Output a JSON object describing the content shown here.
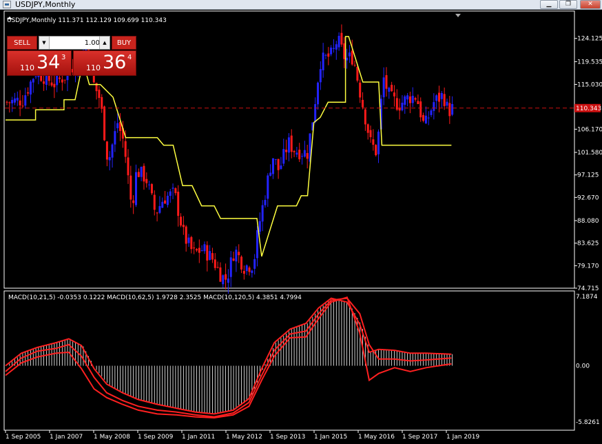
{
  "window": {
    "title": "USDJPY,Monthly",
    "minimize_glyph": "▁",
    "maximize_glyph": "❐",
    "close_glyph": "✕"
  },
  "chart_info": {
    "symbol_line": "USDJPY,Monthly  111.371 112.129 109.699 110.343",
    "indicator_line": "MACD(10,21,5) -0.0353 0.1222  MACD(10,62,5) 1.9728 2.3525  MACD(10,120,5) 4.3851 4.7994"
  },
  "trade_panel": {
    "sell_label": "SELL",
    "buy_label": "BUY",
    "lot_value": "1.00",
    "sell_prefix": "110",
    "sell_big": "34",
    "sell_sup": "3",
    "buy_prefix": "110",
    "buy_big": "36",
    "buy_sup": "4"
  },
  "colors": {
    "background": "#000000",
    "bull": "#2323ff",
    "bear": "#ff1a1a",
    "trail": "#ffff40",
    "macd": "#ff2020",
    "histogram": "#ffffff",
    "current_price_line": "#cc1111"
  },
  "chart_data": {
    "type": "candlestick",
    "price_axis": {
      "ticks": [
        "124.125",
        "119.535",
        "115.030",
        "110.343",
        "106.170",
        "101.580",
        "97.125",
        "92.670",
        "88.080",
        "83.625",
        "79.170",
        "74.715"
      ],
      "current_price": "110.343",
      "range": [
        74.715,
        126.0
      ]
    },
    "macd_axis": {
      "ticks": [
        "7.1874",
        "0.00",
        "-5.8261"
      ],
      "range": [
        -5.8261,
        7.1874
      ]
    },
    "x_labels": [
      "1 Sep 2005",
      "1 Jan 2007",
      "1 May 2008",
      "1 Sep 2009",
      "1 Jan 2011",
      "1 May 2012",
      "1 Sep 2013",
      "1 Jan 2015",
      "1 May 2016",
      "1 Sep 2017",
      "1 Jan 2019"
    ],
    "start_year": 2005.0,
    "end_year": 2019.2,
    "close_path": [
      [
        2005.0,
        111.5
      ],
      [
        2005.5,
        112.0
      ],
      [
        2005.9,
        117.5
      ],
      [
        2006.2,
        116.5
      ],
      [
        2006.5,
        115.2
      ],
      [
        2006.9,
        117.0
      ],
      [
        2007.3,
        120.5
      ],
      [
        2007.5,
        122.5
      ],
      [
        2007.7,
        115.8
      ],
      [
        2007.95,
        112.0
      ],
      [
        2008.2,
        99.5
      ],
      [
        2008.5,
        107.5
      ],
      [
        2008.7,
        103.5
      ],
      [
        2008.95,
        90.5
      ],
      [
        2009.1,
        98.0
      ],
      [
        2009.4,
        96.5
      ],
      [
        2009.7,
        89.5
      ],
      [
        2009.95,
        92.5
      ],
      [
        2010.3,
        93.5
      ],
      [
        2010.6,
        85.0
      ],
      [
        2010.9,
        81.5
      ],
      [
        2011.2,
        82.5
      ],
      [
        2011.5,
        80.5
      ],
      [
        2011.8,
        77.0
      ],
      [
        2011.95,
        76.5
      ],
      [
        2012.2,
        82.5
      ],
      [
        2012.5,
        79.0
      ],
      [
        2012.8,
        79.5
      ],
      [
        2012.95,
        86.5
      ],
      [
        2013.2,
        94.5
      ],
      [
        2013.4,
        101.0
      ],
      [
        2013.6,
        98.0
      ],
      [
        2013.9,
        103.5
      ],
      [
        2014.1,
        102.0
      ],
      [
        2014.5,
        101.5
      ],
      [
        2014.7,
        109.5
      ],
      [
        2014.9,
        119.5
      ],
      [
        2015.3,
        121.0
      ],
      [
        2015.45,
        124.0
      ],
      [
        2015.7,
        120.0
      ],
      [
        2015.95,
        120.5
      ],
      [
        2016.2,
        112.5
      ],
      [
        2016.5,
        103.5
      ],
      [
        2016.7,
        101.5
      ],
      [
        2016.9,
        116.5
      ],
      [
        2017.1,
        112.5
      ],
      [
        2017.4,
        111.0
      ],
      [
        2017.7,
        112.5
      ],
      [
        2017.95,
        112.7
      ],
      [
        2018.2,
        106.5
      ],
      [
        2018.5,
        111.5
      ],
      [
        2018.8,
        113.0
      ],
      [
        2018.95,
        109.7
      ],
      [
        2019.1,
        110.343
      ]
    ],
    "trail_path": [
      [
        2005.0,
        108.0
      ],
      [
        2005.95,
        108.0
      ],
      [
        2005.95,
        110.0
      ],
      [
        2006.85,
        110.0
      ],
      [
        2006.85,
        112.0
      ],
      [
        2007.2,
        112.0
      ],
      [
        2007.45,
        119.5
      ],
      [
        2007.65,
        115.0
      ],
      [
        2008.0,
        115.0
      ],
      [
        2008.4,
        112.5
      ],
      [
        2008.8,
        104.5
      ],
      [
        2009.8,
        104.5
      ],
      [
        2010.0,
        103.0
      ],
      [
        2010.3,
        103.0
      ],
      [
        2010.6,
        95.0
      ],
      [
        2010.9,
        95.0
      ],
      [
        2011.2,
        91.0
      ],
      [
        2011.6,
        91.0
      ],
      [
        2011.8,
        88.5
      ],
      [
        2012.95,
        88.5
      ],
      [
        2013.1,
        81.0
      ],
      [
        2013.4,
        87.0
      ],
      [
        2013.6,
        91.0
      ],
      [
        2014.2,
        91.0
      ],
      [
        2014.35,
        93.0
      ],
      [
        2014.55,
        93.0
      ],
      [
        2014.75,
        107.5
      ],
      [
        2014.95,
        108.5
      ],
      [
        2015.2,
        111.5
      ],
      [
        2015.75,
        111.5
      ],
      [
        2015.75,
        124.5
      ],
      [
        2015.85,
        124.5
      ],
      [
        2016.3,
        115.5
      ],
      [
        2016.8,
        115.5
      ],
      [
        2016.9,
        103.0
      ],
      [
        2019.1,
        103.0
      ]
    ],
    "macd_series": [
      {
        "points": [
          [
            2005.0,
            -0.6
          ],
          [
            2005.5,
            0.8
          ],
          [
            2006.0,
            1.5
          ],
          [
            2006.6,
            1.8
          ],
          [
            2007.0,
            2.2
          ],
          [
            2007.4,
            1.0
          ],
          [
            2007.8,
            -1.2
          ],
          [
            2008.2,
            -2.8
          ],
          [
            2008.7,
            -3.6
          ],
          [
            2009.2,
            -4.2
          ],
          [
            2009.8,
            -4.6
          ],
          [
            2010.4,
            -4.8
          ],
          [
            2011.0,
            -5.1
          ],
          [
            2011.6,
            -5.3
          ],
          [
            2012.2,
            -4.9
          ],
          [
            2012.7,
            -3.8
          ],
          [
            2013.1,
            -1.0
          ],
          [
            2013.5,
            1.6
          ],
          [
            2014.0,
            3.3
          ],
          [
            2014.5,
            3.6
          ],
          [
            2014.9,
            5.4
          ],
          [
            2015.3,
            6.8
          ],
          [
            2015.8,
            7.0
          ],
          [
            2016.2,
            5.4
          ],
          [
            2016.5,
            2.2
          ],
          [
            2016.8,
            0.7
          ],
          [
            2017.3,
            0.7
          ],
          [
            2017.8,
            0.5
          ],
          [
            2018.3,
            0.6
          ],
          [
            2019.1,
            0.8
          ]
        ]
      },
      {
        "points": [
          [
            2005.0,
            0.0
          ],
          [
            2005.5,
            1.3
          ],
          [
            2006.0,
            1.9
          ],
          [
            2006.6,
            2.4
          ],
          [
            2007.0,
            2.8
          ],
          [
            2007.4,
            2.1
          ],
          [
            2007.8,
            -0.3
          ],
          [
            2008.2,
            -1.9
          ],
          [
            2008.7,
            -2.8
          ],
          [
            2009.2,
            -3.5
          ],
          [
            2009.8,
            -4.0
          ],
          [
            2010.4,
            -4.4
          ],
          [
            2011.0,
            -4.8
          ],
          [
            2011.6,
            -5.0
          ],
          [
            2012.2,
            -4.6
          ],
          [
            2012.7,
            -3.4
          ],
          [
            2013.1,
            -0.3
          ],
          [
            2013.5,
            2.4
          ],
          [
            2014.0,
            3.8
          ],
          [
            2014.5,
            4.4
          ],
          [
            2014.9,
            6.0
          ],
          [
            2015.3,
            7.0
          ],
          [
            2015.8,
            6.6
          ],
          [
            2016.2,
            4.3
          ],
          [
            2016.5,
            1.4
          ],
          [
            2016.8,
            1.7
          ],
          [
            2017.3,
            1.6
          ],
          [
            2017.8,
            1.3
          ],
          [
            2018.3,
            1.3
          ],
          [
            2019.1,
            1.2
          ]
        ]
      },
      {
        "points": [
          [
            2005.0,
            -1.0
          ],
          [
            2005.5,
            0.3
          ],
          [
            2006.0,
            0.9
          ],
          [
            2006.6,
            1.3
          ],
          [
            2007.0,
            1.4
          ],
          [
            2007.4,
            -0.3
          ],
          [
            2007.8,
            -2.4
          ],
          [
            2008.2,
            -3.3
          ],
          [
            2008.7,
            -4.0
          ],
          [
            2009.2,
            -4.6
          ],
          [
            2009.8,
            -5.0
          ],
          [
            2010.4,
            -5.1
          ],
          [
            2011.0,
            -5.3
          ],
          [
            2011.6,
            -5.4
          ],
          [
            2012.2,
            -5.1
          ],
          [
            2012.7,
            -4.2
          ],
          [
            2013.1,
            -1.5
          ],
          [
            2013.5,
            1.0
          ],
          [
            2014.0,
            2.9
          ],
          [
            2014.5,
            3.0
          ],
          [
            2014.9,
            4.9
          ],
          [
            2015.3,
            6.6
          ],
          [
            2015.8,
            7.1
          ],
          [
            2016.2,
            3.4
          ],
          [
            2016.5,
            -1.5
          ],
          [
            2016.8,
            -0.8
          ],
          [
            2017.3,
            -0.2
          ],
          [
            2017.8,
            -0.6
          ],
          [
            2018.3,
            -0.2
          ],
          [
            2019.1,
            0.2
          ]
        ]
      }
    ]
  }
}
